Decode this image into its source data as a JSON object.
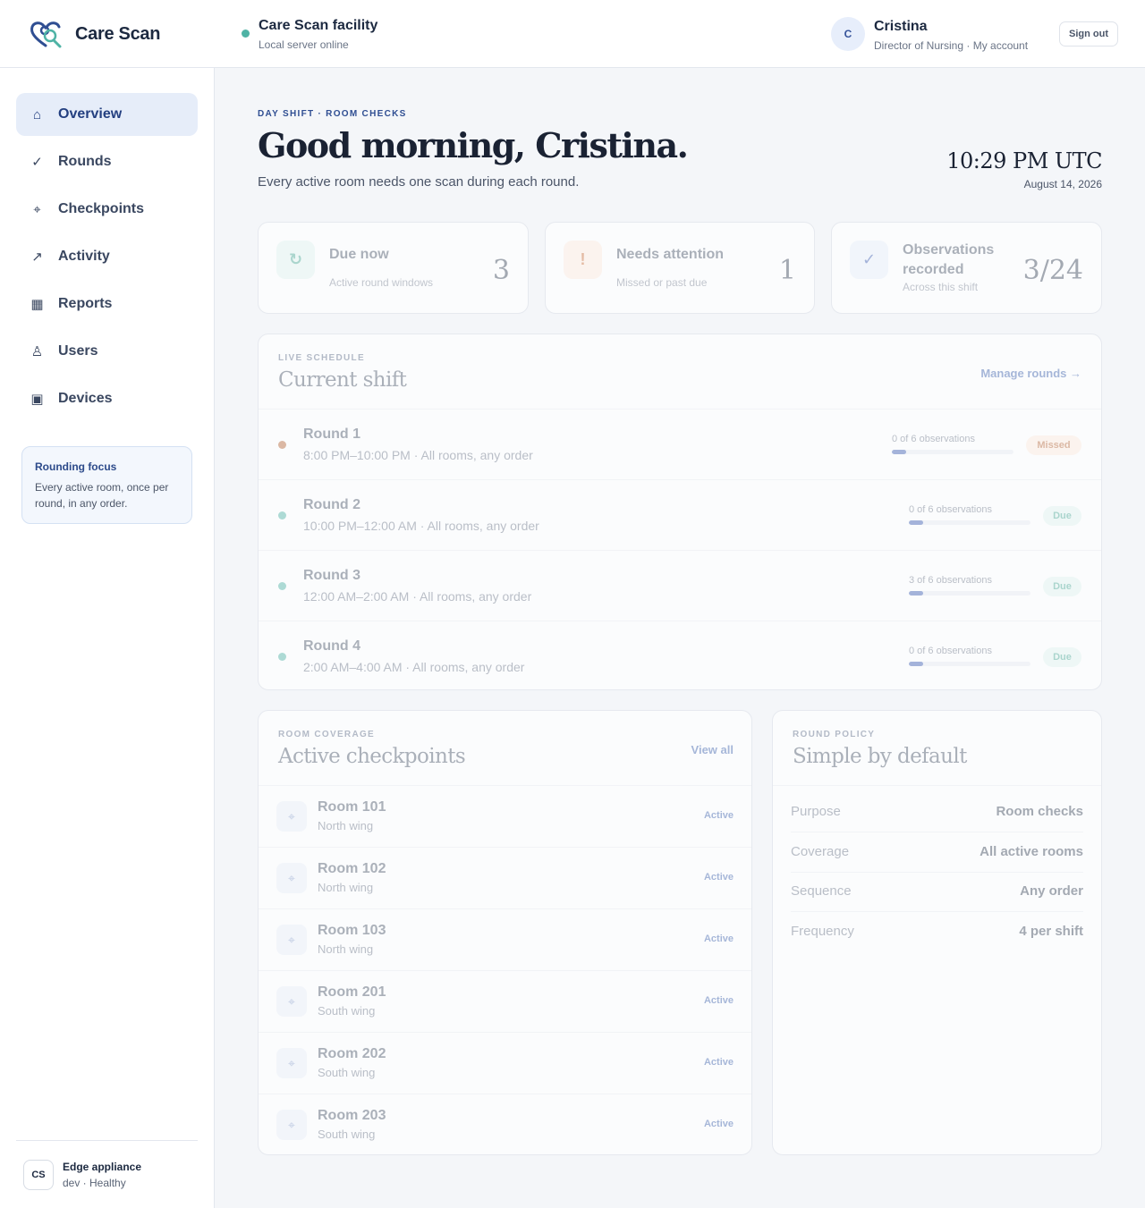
{
  "header": {
    "brand": "Care Scan",
    "facility_name": "Care Scan facility",
    "facility_status": "Local server online",
    "user_initial": "C",
    "user_name": "Cristina",
    "user_role": "Director of Nursing · My account",
    "sign_out": "Sign out"
  },
  "sidebar": {
    "items": [
      {
        "label": "Overview",
        "icon": "⌂"
      },
      {
        "label": "Rounds",
        "icon": "✓"
      },
      {
        "label": "Checkpoints",
        "icon": "⌖"
      },
      {
        "label": "Activity",
        "icon": "↗"
      },
      {
        "label": "Reports",
        "icon": "▦"
      },
      {
        "label": "Users",
        "icon": "♙"
      },
      {
        "label": "Devices",
        "icon": "▣"
      }
    ],
    "focus_title": "Rounding focus",
    "focus_text": "Every active room, once per round, in any order.",
    "device_badge": "CS",
    "device_title": "Edge appliance",
    "device_sub": "dev · Healthy"
  },
  "greeting": {
    "eyebrow": "DAY SHIFT · ROOM CHECKS",
    "title": "Good morning, Cristina.",
    "subtitle": "Every active room needs one scan during each round.",
    "time": "10:29 PM UTC",
    "date": "August 14, 2026"
  },
  "stats": [
    {
      "title": "Due now",
      "sub": "Active round windows",
      "value": "3",
      "icon": "↻"
    },
    {
      "title": "Needs attention",
      "sub": "Missed or past due",
      "value": "1",
      "icon": "!"
    },
    {
      "title": "Observations recorded",
      "sub": "Across this shift",
      "value": "3/24",
      "icon": "✓"
    }
  ],
  "schedule": {
    "eyebrow": "LIVE SCHEDULE",
    "title": "Current shift",
    "link": "Manage rounds →",
    "rounds": [
      {
        "name": "Round 1",
        "time": "8:00 PM–10:00 PM · All rooms, any order",
        "progress_label": "0 of 6 observations",
        "progress": 0.12,
        "status": "Missed"
      },
      {
        "name": "Round 2",
        "time": "10:00 PM–12:00 AM · All rooms, any order",
        "progress_label": "0 of 6 observations",
        "progress": 0.12,
        "status": "Due"
      },
      {
        "name": "Round 3",
        "time": "12:00 AM–2:00 AM · All rooms, any order",
        "progress_label": "3 of 6 observations",
        "progress": 0.12,
        "status": "Due"
      },
      {
        "name": "Round 4",
        "time": "2:00 AM–4:00 AM · All rooms, any order",
        "progress_label": "0 of 6 observations",
        "progress": 0.12,
        "status": "Due"
      }
    ]
  },
  "coverage": {
    "eyebrow": "ROOM COVERAGE",
    "title": "Active checkpoints",
    "link": "View all",
    "rooms": [
      {
        "name": "Room 101",
        "wing": "North wing",
        "status": "Active"
      },
      {
        "name": "Room 102",
        "wing": "North wing",
        "status": "Active"
      },
      {
        "name": "Room 103",
        "wing": "North wing",
        "status": "Active"
      },
      {
        "name": "Room 201",
        "wing": "South wing",
        "status": "Active"
      },
      {
        "name": "Room 202",
        "wing": "South wing",
        "status": "Active"
      },
      {
        "name": "Room 203",
        "wing": "South wing",
        "status": "Active"
      }
    ]
  },
  "policy": {
    "eyebrow": "ROUND POLICY",
    "title": "Simple by default",
    "rows": [
      {
        "key": "Purpose",
        "value": "Room checks"
      },
      {
        "key": "Coverage",
        "value": "All active rooms"
      },
      {
        "key": "Sequence",
        "value": "Any order"
      },
      {
        "key": "Frequency",
        "value": "4 per shift"
      }
    ]
  },
  "colors": {
    "accent": "#2f4e92",
    "status_online": "#4fb3a5",
    "missed": "#b5683a",
    "due": "#4aa795"
  }
}
